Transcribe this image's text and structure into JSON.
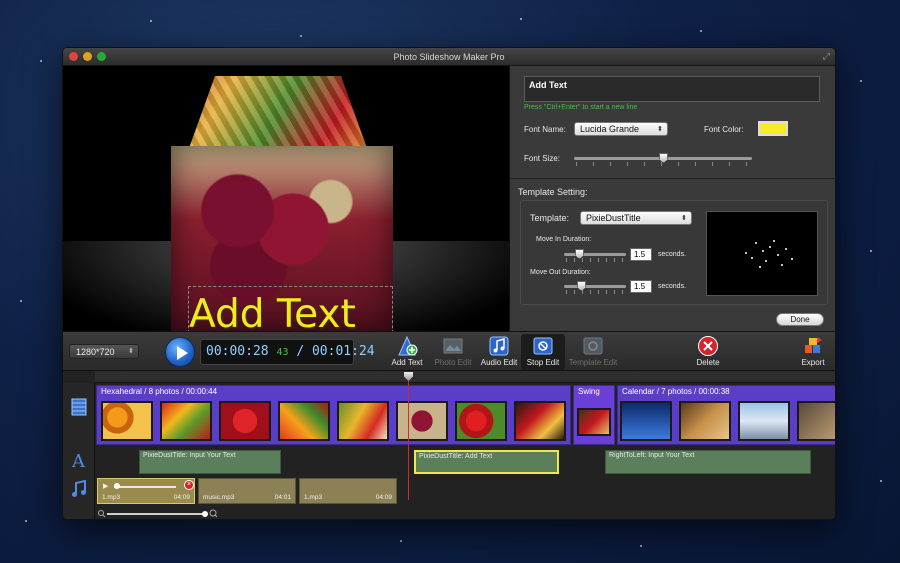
{
  "window": {
    "title": "Photo Slideshow Maker Pro"
  },
  "preview": {
    "overlay_text": "Add Text"
  },
  "text_panel": {
    "text_value": "Add Text",
    "hint": "Press \"Ctrl+Enter\" to start a new line",
    "font_name_label": "Font Name:",
    "font_name_value": "Lucida Grande",
    "font_color_label": "Font Color:",
    "font_color": "#f6ec26",
    "font_size_label": "Font Size:",
    "font_size_level": 0.6
  },
  "template": {
    "section_title": "Template Setting:",
    "template_label": "Template:",
    "template_value": "PixieDustTitle",
    "move_in_label": "Move In Duration:",
    "move_in_value": "1.5",
    "move_out_label": "Move Out Duration:",
    "move_out_value": "1.5",
    "seconds_label": "seconds."
  },
  "done_label": "Done",
  "toolbar": {
    "resolution": "1280*720",
    "time_current": "00:00:28",
    "time_frames": "43",
    "time_separator": "/",
    "time_total": "00:01:24",
    "buttons": {
      "add_text": "Add Text",
      "photo_edit": "Photo Edit",
      "audio_edit": "Audio Edit",
      "stop_edit": "Stop Edit",
      "template_edit": "Template Edit",
      "delete": "Delete",
      "export": "Export"
    }
  },
  "timeline": {
    "photo_groups": [
      {
        "label": "Hexahedral / 8 photos / 00:00:44"
      },
      {
        "label": "Swing"
      },
      {
        "label": "Calendar / 7 photos / 00:00:38"
      }
    ],
    "text_clips": [
      {
        "label": "PixieDustTitle: Input Your Text"
      },
      {
        "label": "PixieDustTitle: Add Text"
      },
      {
        "label": "RightToLeft: Input Your Text"
      }
    ],
    "audio_clips": [
      {
        "name": "1.mp3",
        "duration": "04:09"
      },
      {
        "name": "music.mp3",
        "duration": "04:01"
      },
      {
        "name": "1.mp3",
        "duration": "04:09"
      }
    ]
  }
}
